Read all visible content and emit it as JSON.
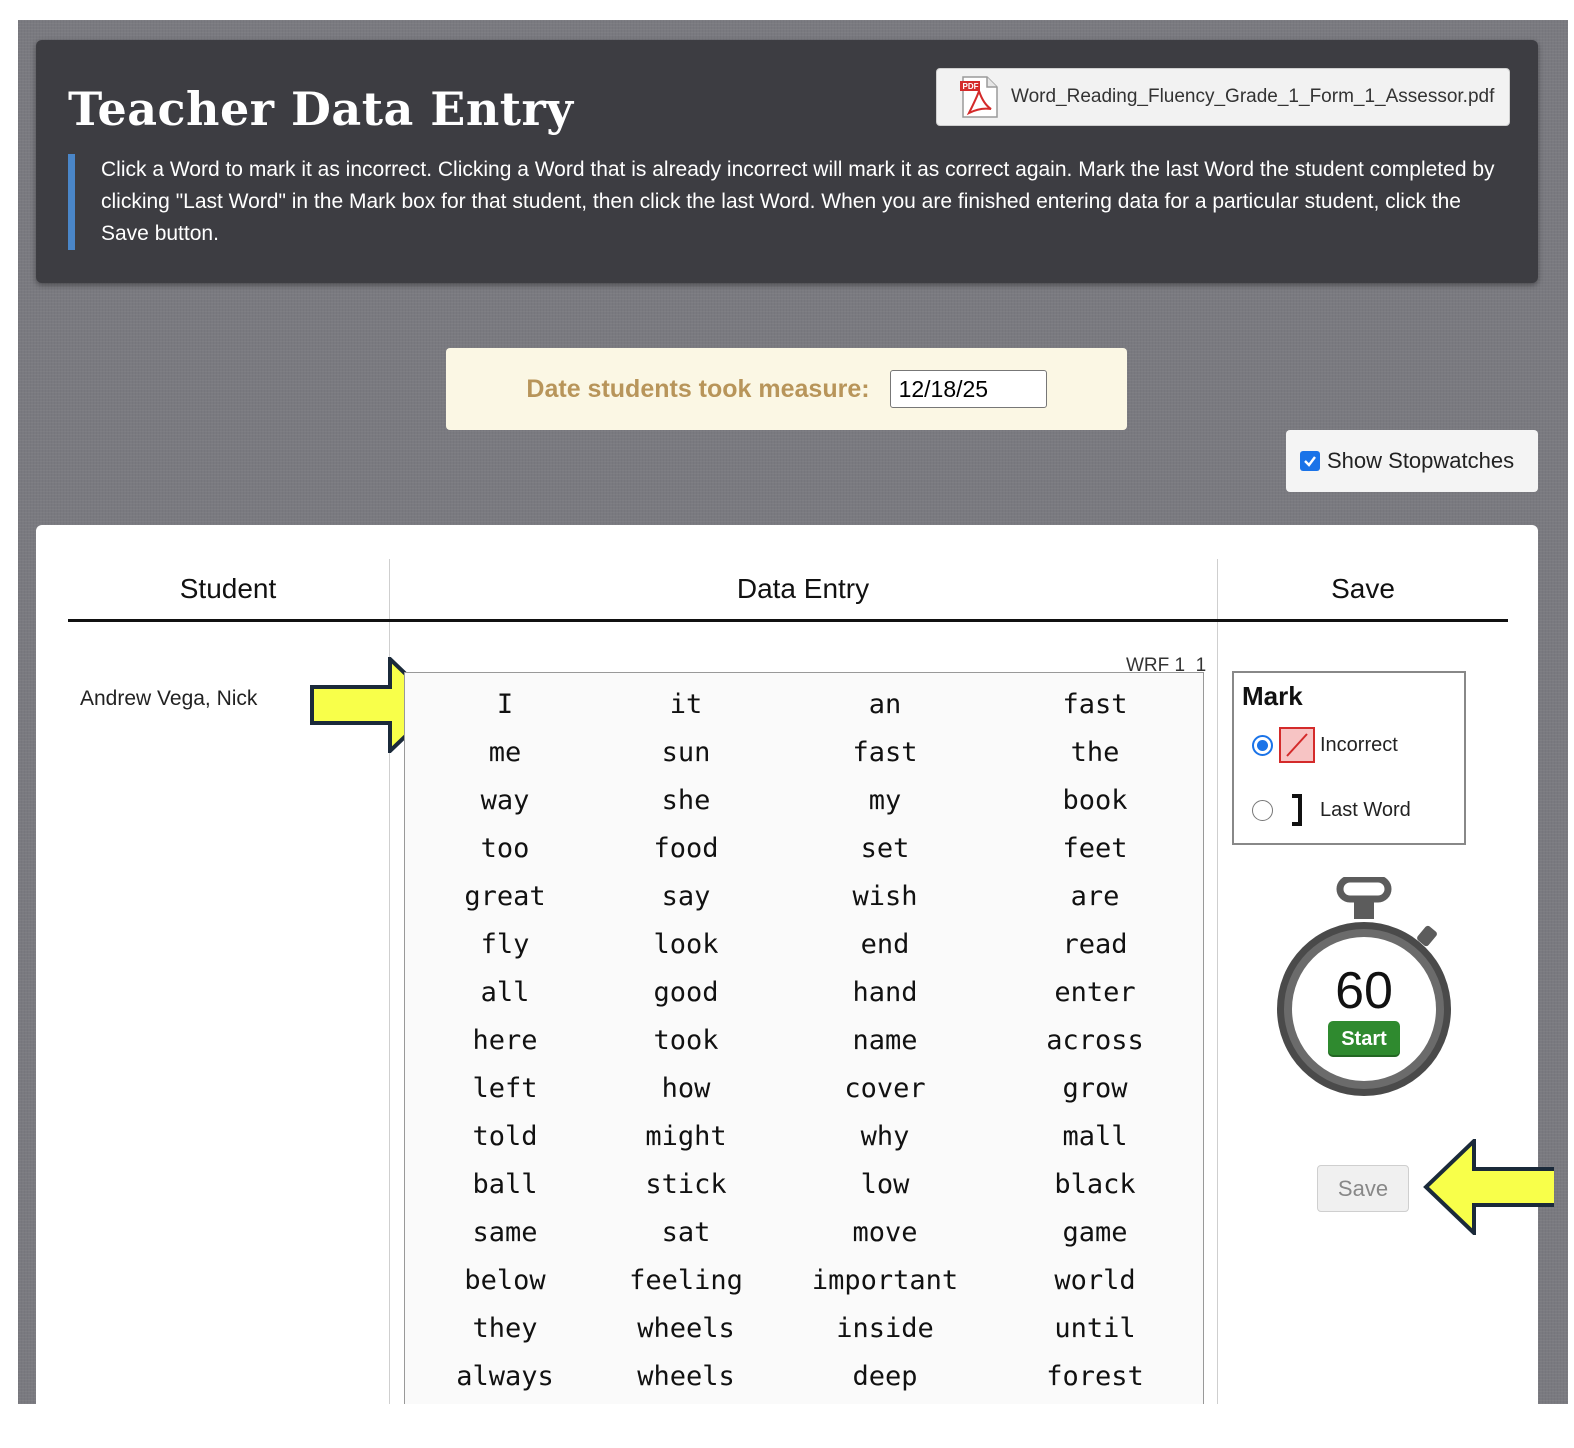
{
  "header": {
    "title": "Teacher Data Entry",
    "pdf_label": "Word_Reading_Fluency_Grade_1_Form_1_Assessor.pdf",
    "instructions": "Click a Word to mark it as incorrect. Clicking a Word that is already incorrect will mark it as correct again. Mark the last Word the student completed by clicking \"Last Word\" in the Mark box for that student, then click the last Word. When you are finished entering data for a particular student, click the Save button."
  },
  "date": {
    "label": "Date students took measure:",
    "value": "12/18/25"
  },
  "stopwatch_toggle": {
    "label": "Show Stopwatches",
    "checked": true
  },
  "table": {
    "headers": {
      "student": "Student",
      "data_entry": "Data Entry",
      "save": "Save"
    },
    "student_name": "Andrew Vega, Nick",
    "form_id": "WRF 1_1",
    "words": [
      [
        "I",
        "it",
        "an",
        "fast"
      ],
      [
        "me",
        "sun",
        "fast",
        "the"
      ],
      [
        "way",
        "she",
        "my",
        "book"
      ],
      [
        "too",
        "food",
        "set",
        "feet"
      ],
      [
        "great",
        "say",
        "wish",
        "are"
      ],
      [
        "fly",
        "look",
        "end",
        "read"
      ],
      [
        "all",
        "good",
        "hand",
        "enter"
      ],
      [
        "here",
        "took",
        "name",
        "across"
      ],
      [
        "left",
        "how",
        "cover",
        "grow"
      ],
      [
        "told",
        "might",
        "why",
        "mall"
      ],
      [
        "ball",
        "stick",
        "low",
        "black"
      ],
      [
        "same",
        "sat",
        "move",
        "game"
      ],
      [
        "below",
        "feeling",
        "important",
        "world"
      ],
      [
        "they",
        "wheels",
        "inside",
        "until"
      ],
      [
        "always",
        "wheels",
        "deep",
        "forest"
      ]
    ]
  },
  "mark": {
    "title": "Mark",
    "options": [
      {
        "label": "Incorrect",
        "selected": true
      },
      {
        "label": "Last Word",
        "selected": false
      }
    ]
  },
  "stopwatch": {
    "seconds": "60",
    "start_label": "Start"
  },
  "save_label": "Save",
  "colors": {
    "accent_blue": "#1a73e8",
    "instruction_bar": "#4a86c8",
    "date_label": "#b8955a",
    "start_green": "#2f8a2f",
    "arrow_yellow": "#f8ff4a"
  }
}
